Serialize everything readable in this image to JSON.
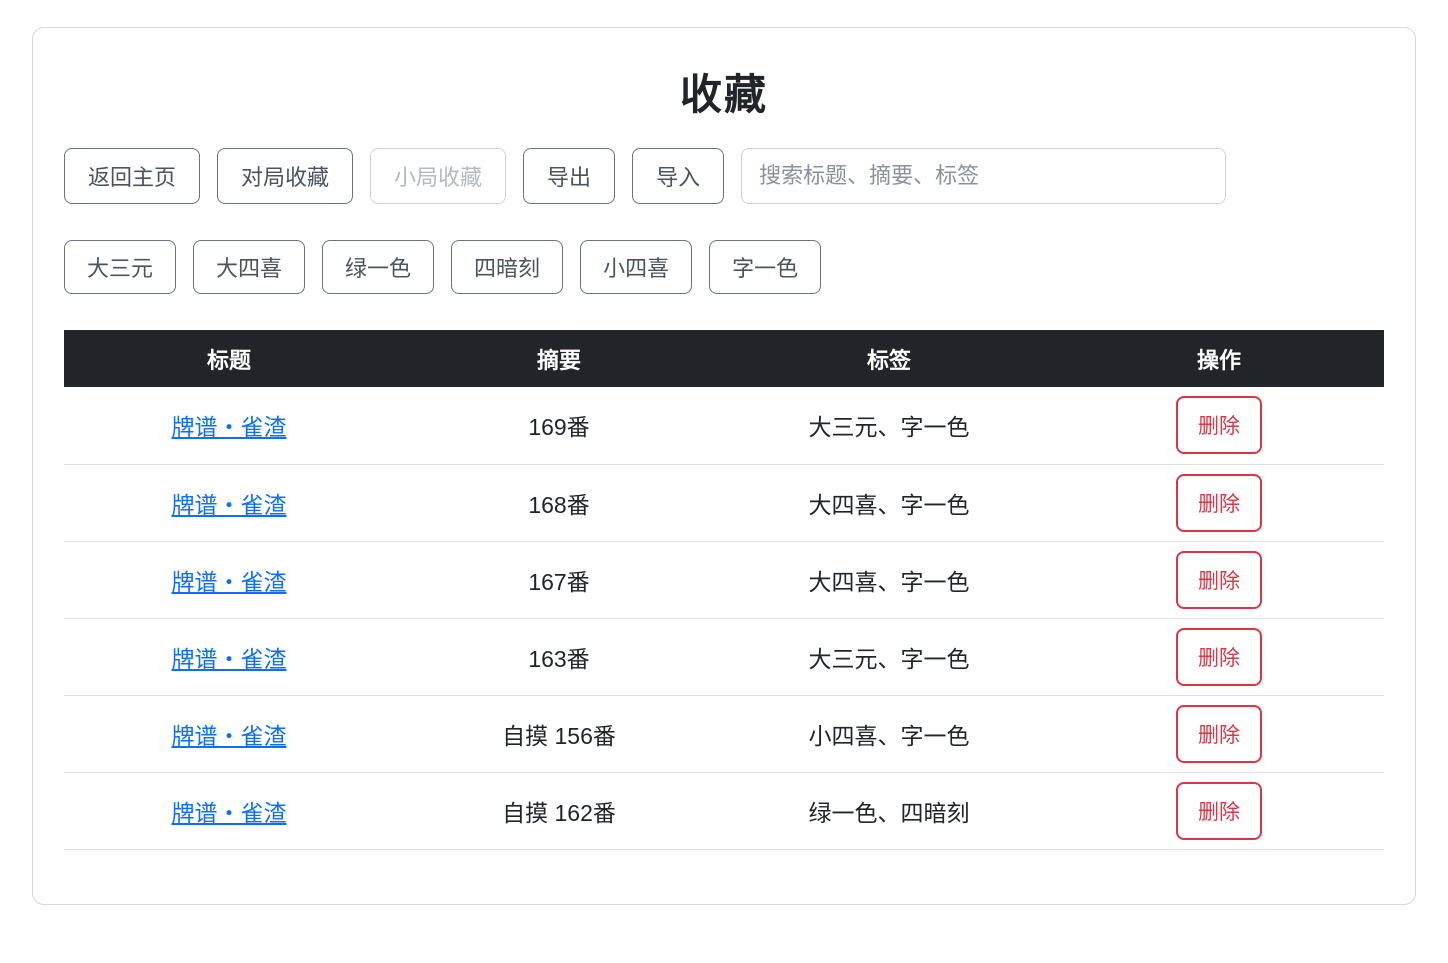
{
  "header": {
    "title": "收藏"
  },
  "toolbar": {
    "buttons": [
      {
        "label": "返回主页",
        "disabled": false
      },
      {
        "label": "对局收藏",
        "disabled": false
      },
      {
        "label": "小局收藏",
        "disabled": true
      },
      {
        "label": "导出",
        "disabled": false
      },
      {
        "label": "导入",
        "disabled": false
      }
    ],
    "search_placeholder": "搜索标题、摘要、标签"
  },
  "tag_filters": [
    "大三元",
    "大四喜",
    "绿一色",
    "四暗刻",
    "小四喜",
    "字一色"
  ],
  "table": {
    "headers": [
      "标题",
      "摘要",
      "标签",
      "操作"
    ],
    "delete_label": "删除",
    "rows": [
      {
        "title": "牌谱・雀渣",
        "summary": "169番",
        "tags": "大三元、字一色"
      },
      {
        "title": "牌谱・雀渣",
        "summary": "168番",
        "tags": "大四喜、字一色"
      },
      {
        "title": "牌谱・雀渣",
        "summary": "167番",
        "tags": "大四喜、字一色"
      },
      {
        "title": "牌谱・雀渣",
        "summary": "163番",
        "tags": "大三元、字一色"
      },
      {
        "title": "牌谱・雀渣",
        "summary": "自摸 156番",
        "tags": "小四喜、字一色"
      },
      {
        "title": "牌谱・雀渣",
        "summary": "自摸 162番",
        "tags": "绿一色、四暗刻"
      }
    ]
  },
  "colors": {
    "header_bg": "#212529",
    "link_blue": "#0d6efd",
    "danger_red": "#dc3545"
  }
}
